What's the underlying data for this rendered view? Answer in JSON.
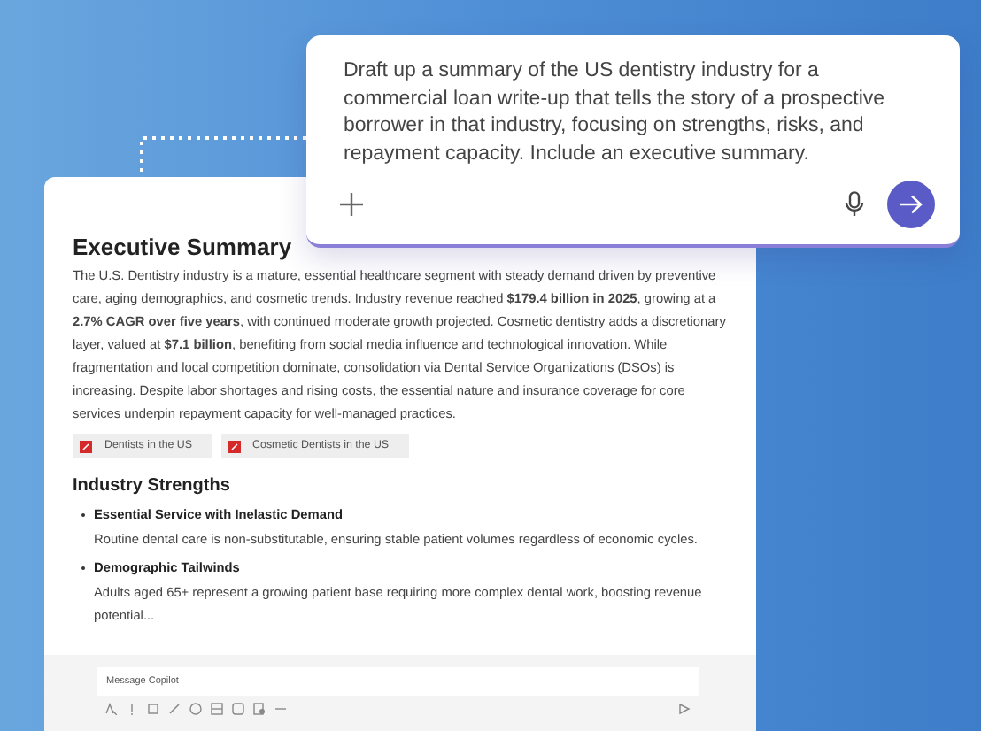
{
  "prompt": {
    "text": "Draft up a summary of the US dentistry industry for a commercial loan write-up that tells the story of a prospective borrower in that industry, focusing on strengths, risks, and repayment capacity. Include an executive summary."
  },
  "document": {
    "title": "Executive Summary",
    "paragraph": "The U.S. Dentistry industry is a mature, essential healthcare segment with steady demand driven by preventive care, aging demographics, and cosmetic trends. Industry revenue reached **$179.4 billion in 2025**, growing at a **2.7% CAGR over five years**, with continued moderate growth projected. Cosmetic dentistry adds a discretionary layer, valued at **$7.1 billion**, benefiting from social media influence and technological innovation. While fragmentation and local competition dominate, consolidation via Dental Service Organizations (DSOs) is increasing. Despite labor shortages and rising costs, the essential nature and insurance coverage for core services underpin repayment capacity for well-managed practices.",
    "sources": [
      "Dentists in the US",
      "Cosmetic Dentists in the US"
    ],
    "section_heading": "Industry Strengths",
    "items": [
      {
        "title": "Essential Service with Inelastic Demand",
        "text": "Routine dental care is non-substitutable, ensuring stable patient volumes regardless of economic cycles."
      },
      {
        "title": "Demographic Tailwinds",
        "text": "Adults aged 65+ represent a growing patient base requiring more complex dental work, boosting revenue potential..."
      }
    ]
  },
  "composer": {
    "placeholder": "Message Copilot"
  }
}
